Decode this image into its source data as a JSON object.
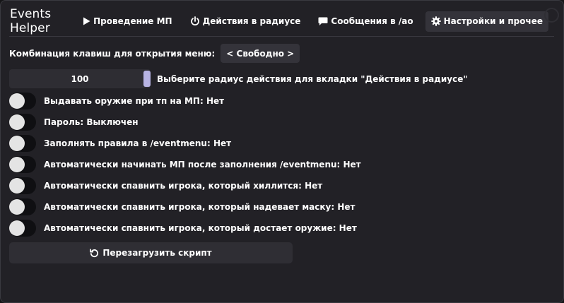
{
  "app_title": "Events Helper",
  "tabs": [
    {
      "label": "Проведение МП",
      "icon": "play-icon",
      "active": false
    },
    {
      "label": "Действия в радиусе",
      "icon": "power-icon",
      "active": false
    },
    {
      "label": "Сообщения в /ao",
      "icon": "message-icon",
      "active": false
    },
    {
      "label": "Настройки и прочее",
      "icon": "gear-icon",
      "active": true
    }
  ],
  "settings": {
    "hotkey_label": "Комбинация клавиш для открытия меню:",
    "hotkey_value": "< Свободно >",
    "radius_value": "100",
    "radius_label": "Выберите радиус действия для вкладки \"Действия в радиусе\"",
    "toggles": [
      {
        "label": "Выдавать оружие при тп на МП: Нет",
        "on": false
      },
      {
        "label": "Пароль: Выключен",
        "on": false
      },
      {
        "label": "Заполнять правила в /eventmenu: Нет",
        "on": false
      },
      {
        "label": "Автоматически начинать МП после заполнения /eventmenu: Нет",
        "on": false
      },
      {
        "label": "Автоматически спавнить игрока, который хиллится: Нет",
        "on": false
      },
      {
        "label": "Автоматически спавнить игрока, который надевает маску: Нет",
        "on": false
      },
      {
        "label": "Автоматически спавнить игрока, который достает оружие: Нет",
        "on": false
      }
    ],
    "reload_label": "Перезагрузить скрипт"
  },
  "colors": {
    "window_bg": "#222126",
    "button_bg": "#34333a",
    "slider_thumb": "#b7b3e3",
    "toggle_track": "#0f0f12",
    "toggle_knob": "#e4e4e4"
  }
}
